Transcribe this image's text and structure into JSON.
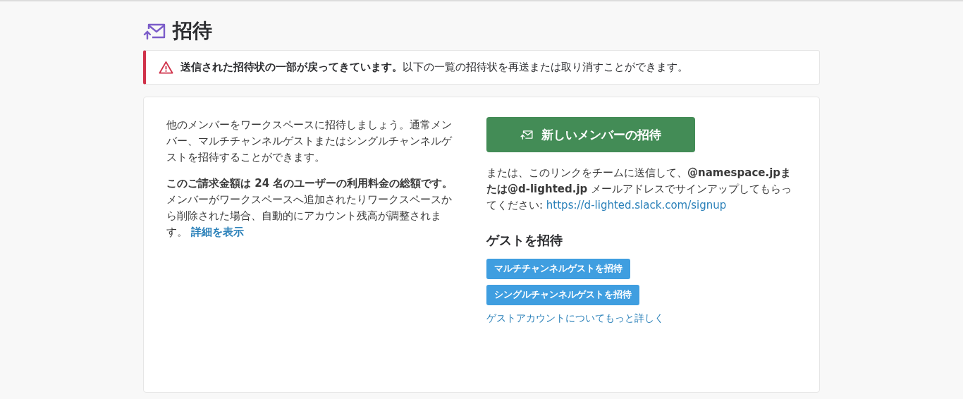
{
  "page": {
    "title": "招待"
  },
  "alert": {
    "text": "**送信された招待状の一部が戻ってきています。**以下の一覧の招待状を再送または取り消すことができます。"
  },
  "intro": {
    "paragraphs": [
      {
        "text": "他のメンバーをワークスペースに招待しましょう。通常メンバー、マルチチャンネルゲストまたはシングルチャンネルゲストを招待することができます。"
      },
      {
        "text": "**このご請求金額は 24 名のユーザーの利用料金の総額です。**メンバーがワークスペースへ追加されたりワークスペースから削除された場合、自動的にアカウント残高が調整されます。",
        "link": "詳細を表示"
      }
    ]
  },
  "invite": {
    "button": "新しいメンバーの招待",
    "note": "または、このリンクをチームに送信して、**@namespace.jpまたは@d-lighted.jp** メールアドレスでサインアップしてもらってください:",
    "link": "https://d-lighted.slack.com/signup"
  },
  "guests": {
    "heading": "ゲストを招待",
    "buttons": [
      "マルチチャンネルゲストを招待",
      "シングルチャンネルゲストを招待"
    ],
    "link": "ゲストアカウントについてもっと詳しく"
  }
}
